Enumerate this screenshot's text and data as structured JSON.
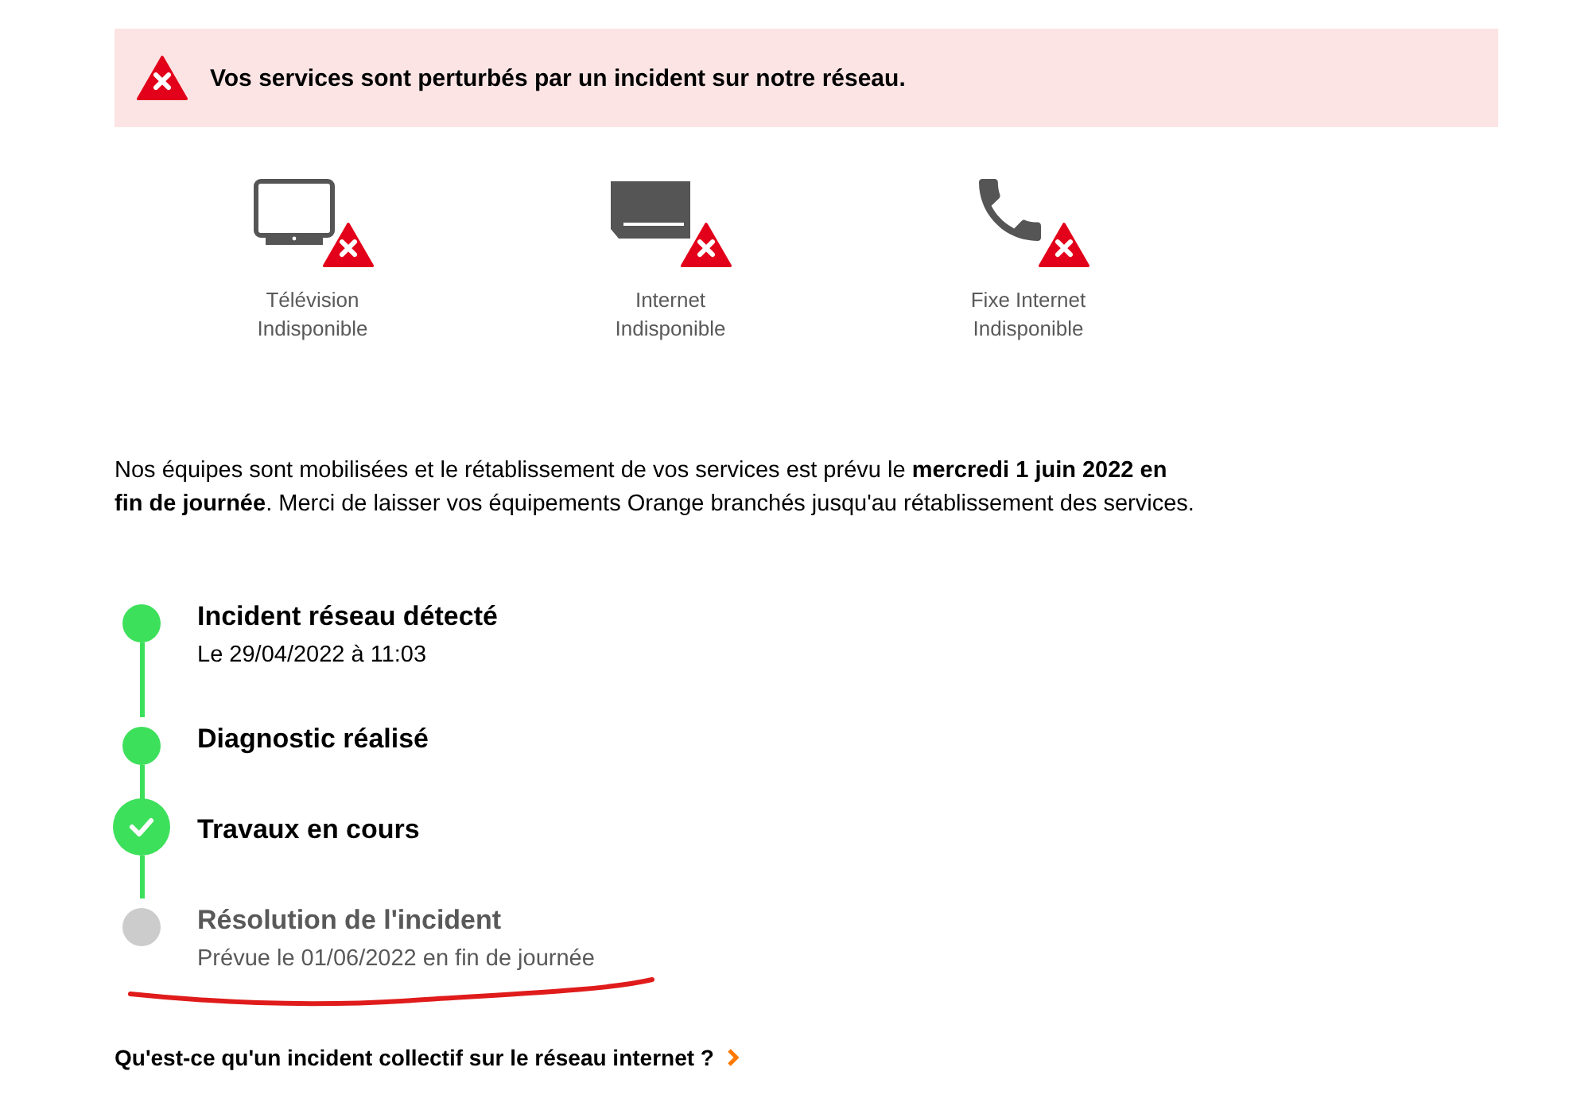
{
  "alert": {
    "message": "Vos services sont perturbés par un incident sur notre réseau."
  },
  "services": [
    {
      "kind": "tv",
      "name": "Télévision",
      "status": "Indisponible"
    },
    {
      "kind": "box",
      "name": "Internet",
      "status": "Indisponible"
    },
    {
      "kind": "phone",
      "name": "Fixe Internet",
      "status": "Indisponible"
    }
  ],
  "info": "Nos équipes sont mobilisées et le rétablissement de vos services est prévu le **mercredi 1 juin 2022 en fin de journée**. Merci de laisser vos équipements Orange branchés jusqu'au rétablissement des services.",
  "steps": [
    {
      "kind": "done",
      "title": "Incident réseau détecté",
      "detail": "Le 29/04/2022 à 11:03"
    },
    {
      "kind": "done",
      "title": "Diagnostic réalisé"
    },
    {
      "kind": "current",
      "title": "Travaux en cours"
    },
    {
      "kind": "pending",
      "title": "Résolution de l'incident",
      "detail": "Prévue le 01/06/2022 en fin de journée"
    }
  ],
  "link": {
    "label": "Qu'est-ce qu'un incident collectif sur le réseau internet ?"
  }
}
